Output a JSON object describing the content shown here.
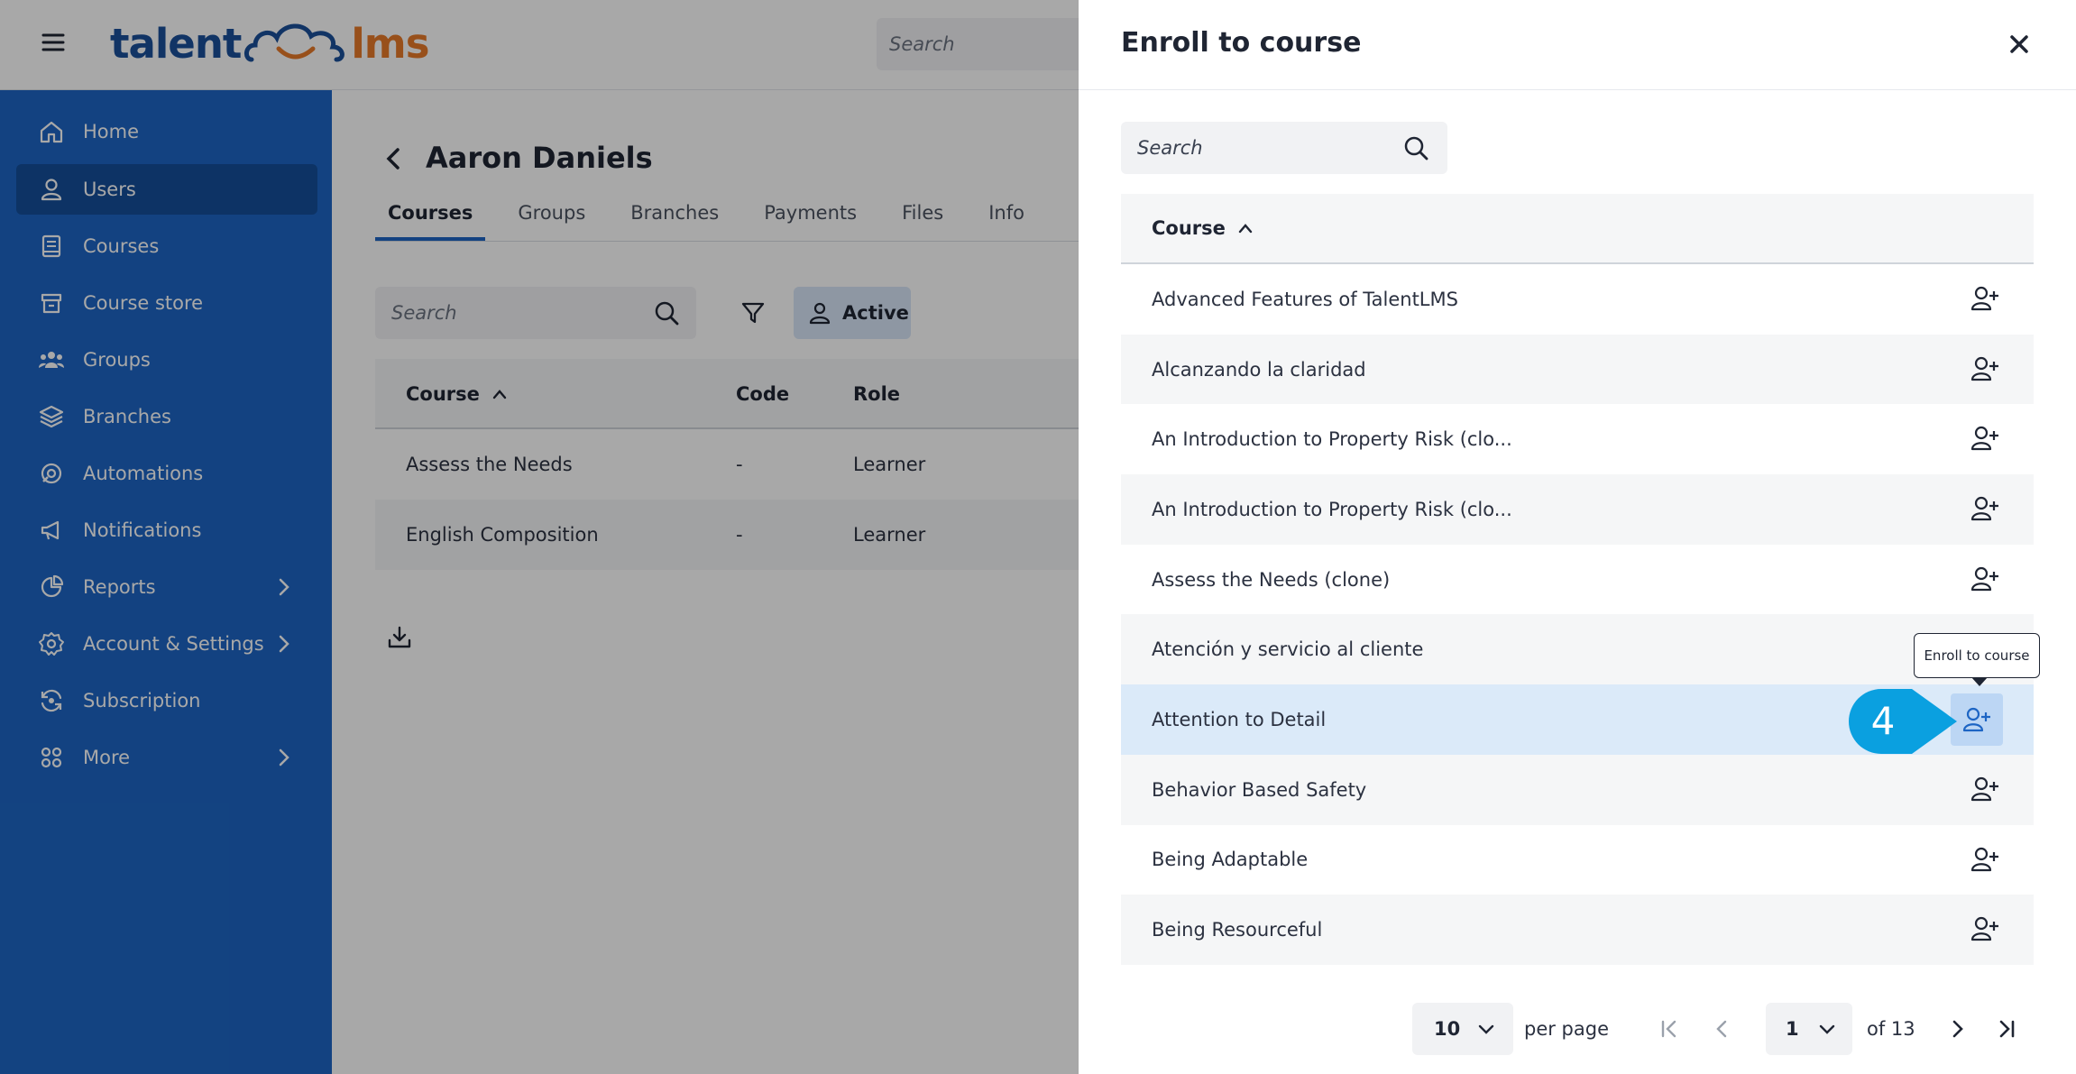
{
  "topbar": {
    "logo_left": "talent",
    "logo_right": "lms",
    "search_placeholder": "Search"
  },
  "colors": {
    "sidebar": "#1d65c4",
    "sidebar_active": "#144e9a",
    "accent": "#1d65c4",
    "logo_blue": "#1a4f9a",
    "logo_orange": "#e77a2a",
    "badge": "#0aa0e0",
    "row_highlight": "#dbeaf9"
  },
  "sidebar": {
    "items": [
      {
        "label": "Home",
        "icon": "home-icon"
      },
      {
        "label": "Users",
        "icon": "user-icon",
        "active": true
      },
      {
        "label": "Courses",
        "icon": "book-icon"
      },
      {
        "label": "Course store",
        "icon": "store-icon"
      },
      {
        "label": "Groups",
        "icon": "groups-icon"
      },
      {
        "label": "Branches",
        "icon": "layers-icon"
      },
      {
        "label": "Automations",
        "icon": "automation-icon"
      },
      {
        "label": "Notifications",
        "icon": "megaphone-icon"
      },
      {
        "label": "Reports",
        "icon": "pie-chart-icon",
        "has_submenu": true
      },
      {
        "label": "Account & Settings",
        "icon": "gear-icon",
        "has_submenu": true
      },
      {
        "label": "Subscription",
        "icon": "subscription-icon"
      },
      {
        "label": "More",
        "icon": "grid-icon",
        "has_submenu": true
      }
    ]
  },
  "main": {
    "user_name": "Aaron Daniels",
    "tabs": [
      "Courses",
      "Groups",
      "Branches",
      "Payments",
      "Files",
      "Info"
    ],
    "search_placeholder": "Search",
    "status_filter": "Active",
    "table": {
      "headers": [
        "Course",
        "Code",
        "Role"
      ],
      "rows": [
        [
          "Assess the Needs",
          "-",
          "Learner"
        ],
        [
          "English Composition",
          "-",
          "Learner"
        ]
      ]
    }
  },
  "drawer": {
    "title": "Enroll to course",
    "search_placeholder": "Search",
    "column_header": "Course",
    "courses": [
      "Advanced Features of TalentLMS",
      "Alcanzando la claridad",
      "An Introduction to Property Risk (clo...",
      "An Introduction to Property Risk (clo...",
      "Assess the Needs (clone)",
      "Atención y servicio al cliente",
      "Attention to Detail",
      "Behavior Based Safety",
      "Being Adaptable",
      "Being Resourceful"
    ],
    "highlighted_index": 6,
    "tooltip": "Enroll to course",
    "step_number": "4",
    "pagination": {
      "per_page": "10",
      "per_page_label": "per page",
      "current_page": "1",
      "of_label": "of 13"
    }
  }
}
